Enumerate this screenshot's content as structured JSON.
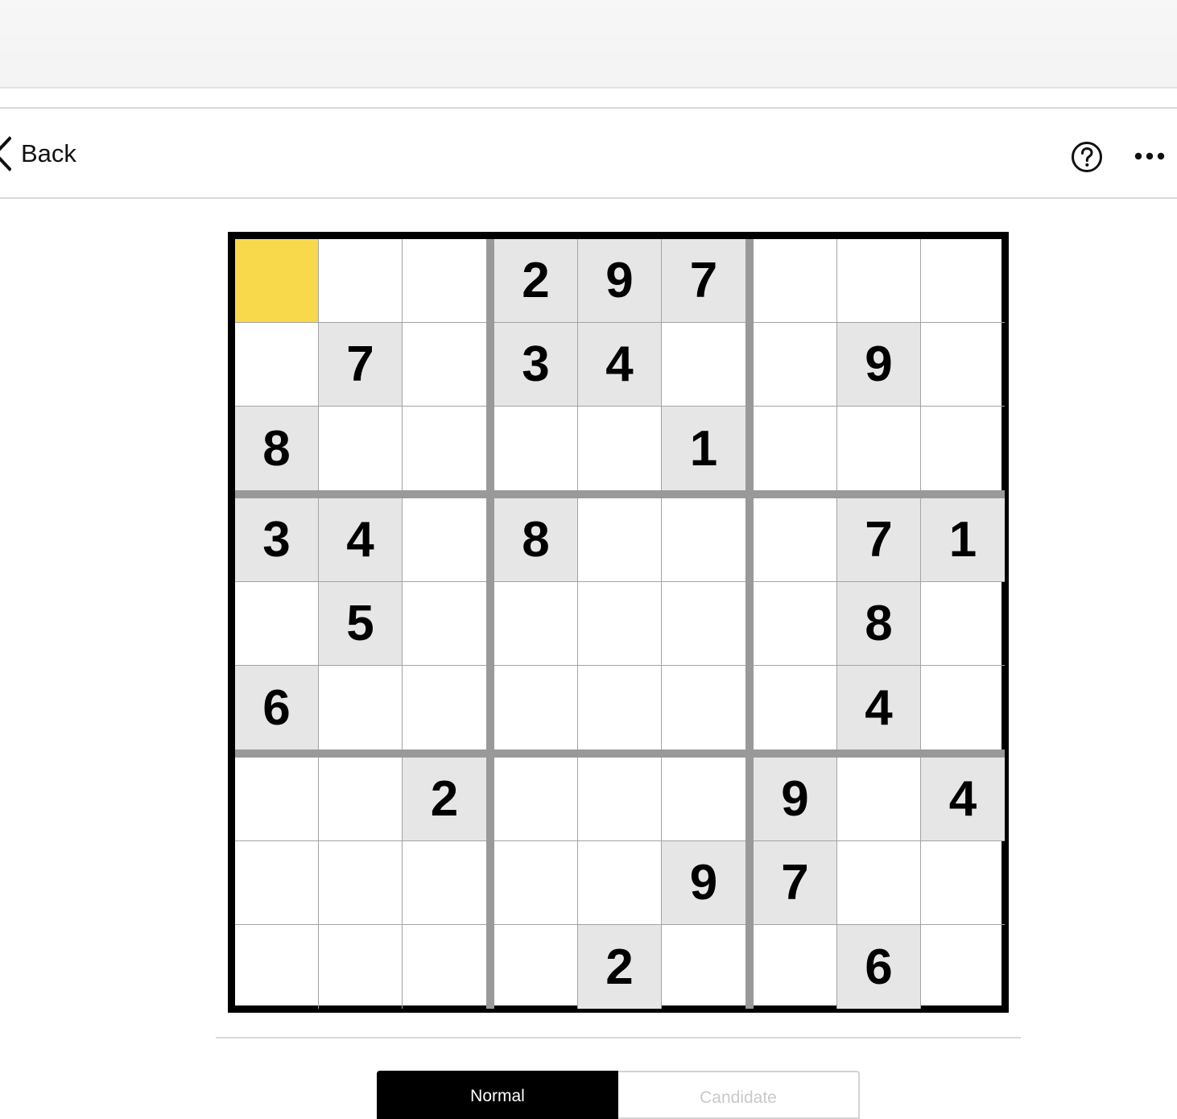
{
  "nav": {
    "back_label": "Back",
    "help_icon": "help-circle-icon",
    "more_icon": "ellipsis-icon"
  },
  "puzzle": {
    "selected": {
      "row": 0,
      "col": 0
    },
    "selected_color": "#f8d94c",
    "given_color": "#e6e6e6",
    "grid": [
      [
        "",
        "",
        "",
        "2",
        "9",
        "7",
        "",
        "",
        ""
      ],
      [
        "",
        "7",
        "",
        "3",
        "4",
        "",
        "",
        "9",
        ""
      ],
      [
        "8",
        "",
        "",
        "",
        "",
        "1",
        "",
        "",
        ""
      ],
      [
        "3",
        "4",
        "",
        "8",
        "",
        "",
        "",
        "7",
        "1"
      ],
      [
        "",
        "5",
        "",
        "",
        "",
        "",
        "",
        "8",
        ""
      ],
      [
        "6",
        "",
        "",
        "",
        "",
        "",
        "",
        "4",
        ""
      ],
      [
        "",
        "",
        "2",
        "",
        "",
        "",
        "9",
        "",
        "4"
      ],
      [
        "",
        "",
        "",
        "",
        "",
        "9",
        "7",
        "",
        ""
      ],
      [
        "",
        "",
        "",
        "",
        "2",
        "",
        "",
        "6",
        ""
      ]
    ]
  },
  "mode": {
    "options": [
      "Normal",
      "Candidate"
    ],
    "active": "Normal"
  }
}
